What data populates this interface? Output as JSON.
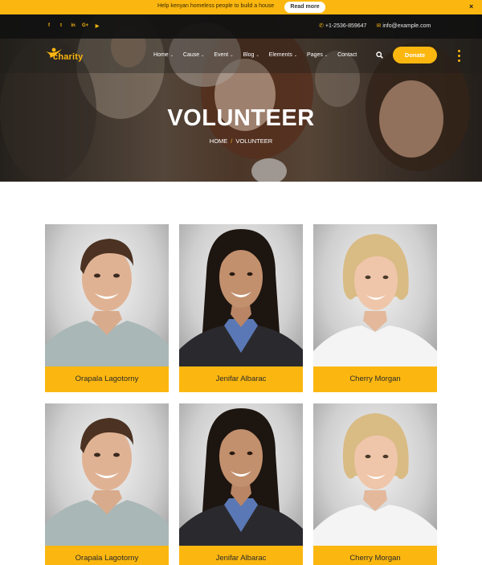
{
  "announcement": {
    "message": "Help kenyan homeless people to build a house",
    "button_label": "Read more",
    "close_glyph": "×"
  },
  "topbar": {
    "social_icons": [
      "facebook-icon",
      "twitter-icon",
      "linkedin-icon",
      "google-plus-icon",
      "youtube-icon"
    ],
    "social_glyphs": [
      "f",
      "t",
      "in",
      "G+",
      "▶"
    ],
    "phone": "+1-2536-859647",
    "email": "info@example.com"
  },
  "nav": {
    "logo_text": "charity",
    "items": [
      {
        "label": "Home",
        "has_dropdown": true
      },
      {
        "label": "Cause",
        "has_dropdown": true
      },
      {
        "label": "Event",
        "has_dropdown": true
      },
      {
        "label": "Blog",
        "has_dropdown": true
      },
      {
        "label": "Elements",
        "has_dropdown": true
      },
      {
        "label": "Pages",
        "has_dropdown": true
      },
      {
        "label": "Contact",
        "has_dropdown": false
      }
    ],
    "donate_label": "Donate"
  },
  "hero": {
    "title": "VOLUNTEER",
    "breadcrumb": [
      "HOME",
      "VOLUNTEER"
    ],
    "breadcrumb_separator": "/"
  },
  "volunteers": [
    {
      "name": "Orapala Lagotorny",
      "photo": "man"
    },
    {
      "name": "Jenifar Albarac",
      "photo": "woman-dark"
    },
    {
      "name": "Cherry Morgan",
      "photo": "woman-blonde"
    },
    {
      "name": "Orapala Lagotorny",
      "photo": "man"
    },
    {
      "name": "Jenifar Albarac",
      "photo": "woman-dark"
    },
    {
      "name": "Cherry Morgan",
      "photo": "woman-blonde"
    }
  ],
  "colors": {
    "accent": "#fbb710",
    "topbar": "#111111",
    "hero_overlay": "#2a241f"
  }
}
